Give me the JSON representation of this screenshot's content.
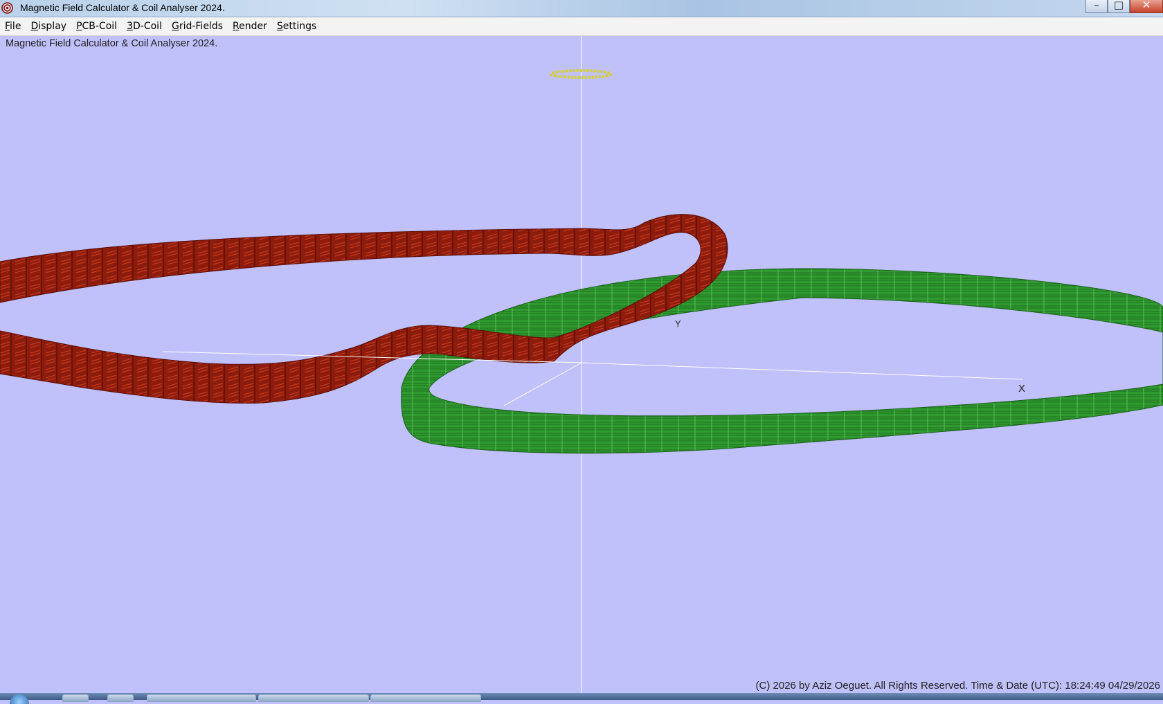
{
  "window": {
    "title": "Magnetic Field Calculator & Coil Analyser 2024.",
    "controls": {
      "minimize": "–",
      "maximize": "□",
      "close": "✕"
    }
  },
  "menu": [
    {
      "label": "File",
      "accel": "F",
      "rest": "ile"
    },
    {
      "label": "Display",
      "accel": "D",
      "rest": "isplay"
    },
    {
      "label": "PCB-Coil",
      "accel": "P",
      "rest": "CB-Coil"
    },
    {
      "label": "3D-Coil",
      "accel": "3",
      "rest": "D-Coil"
    },
    {
      "label": "Grid-Fields",
      "accel": "G",
      "rest": "rid-Fields"
    },
    {
      "label": "Render",
      "accel": "R",
      "rest": "ender"
    },
    {
      "label": "Settings",
      "accel": "S",
      "rest": "ettings"
    }
  ],
  "viewport": {
    "caption": "Magnetic Field Calculator & Coil Analyser 2024.",
    "axis_labels": {
      "x": "X",
      "y": "Y"
    },
    "footer": "(C) 2026  by Aziz Oeguet. All Rights Reserved.  Time & Date (UTC): 18:24:49  04/29/2026"
  },
  "colors": {
    "background": "#c0c0fb",
    "coil_red": "#8b1a0a",
    "coil_green": "#2b8a2b",
    "small_coil": "#d8d020",
    "axes": "#ffffff"
  }
}
